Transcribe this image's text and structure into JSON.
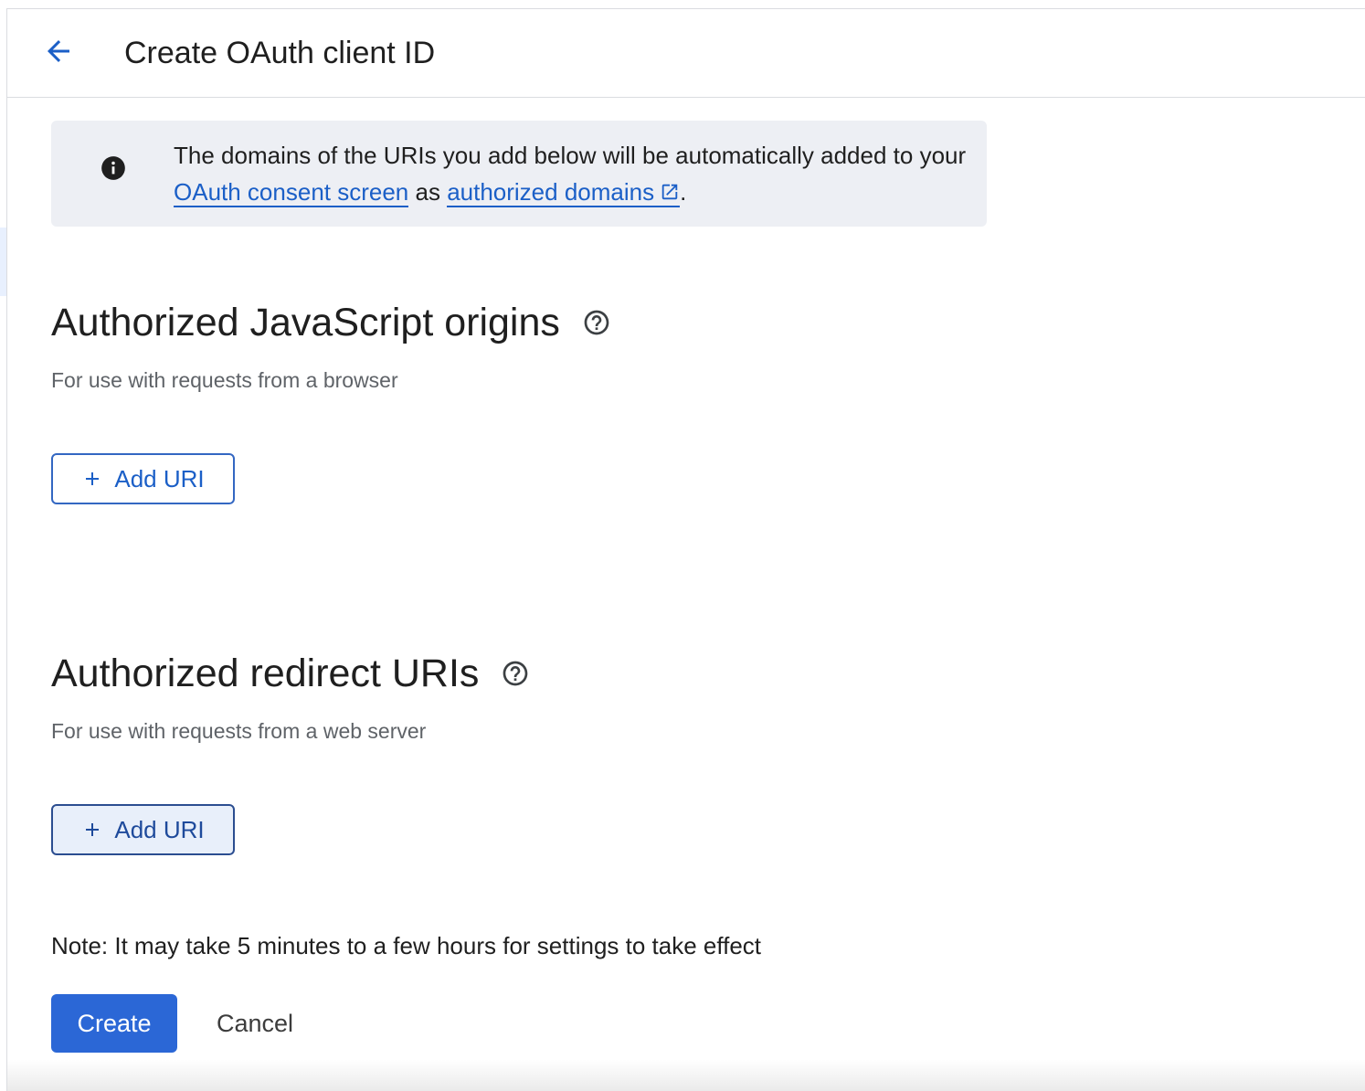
{
  "header": {
    "back_icon": "arrow-back-icon",
    "title": "Create OAuth client ID"
  },
  "info_banner": {
    "icon": "info-icon",
    "text_before": "The domains of the URIs you add below will be automatically added to your ",
    "link_consent": "OAuth consent screen",
    "text_middle": " as ",
    "link_domains": "authorized domains",
    "external_icon": "open-in-new-icon",
    "text_after": "."
  },
  "js_origins": {
    "title": "Authorized JavaScript origins",
    "help_icon": "help-outline-icon",
    "subtitle": "For use with requests from a browser",
    "add_button_label": "Add URI"
  },
  "redirect_uris": {
    "title": "Authorized redirect URIs",
    "help_icon": "help-outline-icon",
    "subtitle": "For use with requests from a web server",
    "add_button_label": "Add URI"
  },
  "note": "Note: It may take 5 minutes to a few hours for settings to take effect",
  "actions": {
    "create_label": "Create",
    "cancel_label": "Cancel"
  },
  "colors": {
    "accent": "#1b5fc7",
    "primary_button": "#2b67d6",
    "banner_bg": "#edeff4",
    "text": "#1f1f1f",
    "secondary_text": "#5f6368"
  }
}
